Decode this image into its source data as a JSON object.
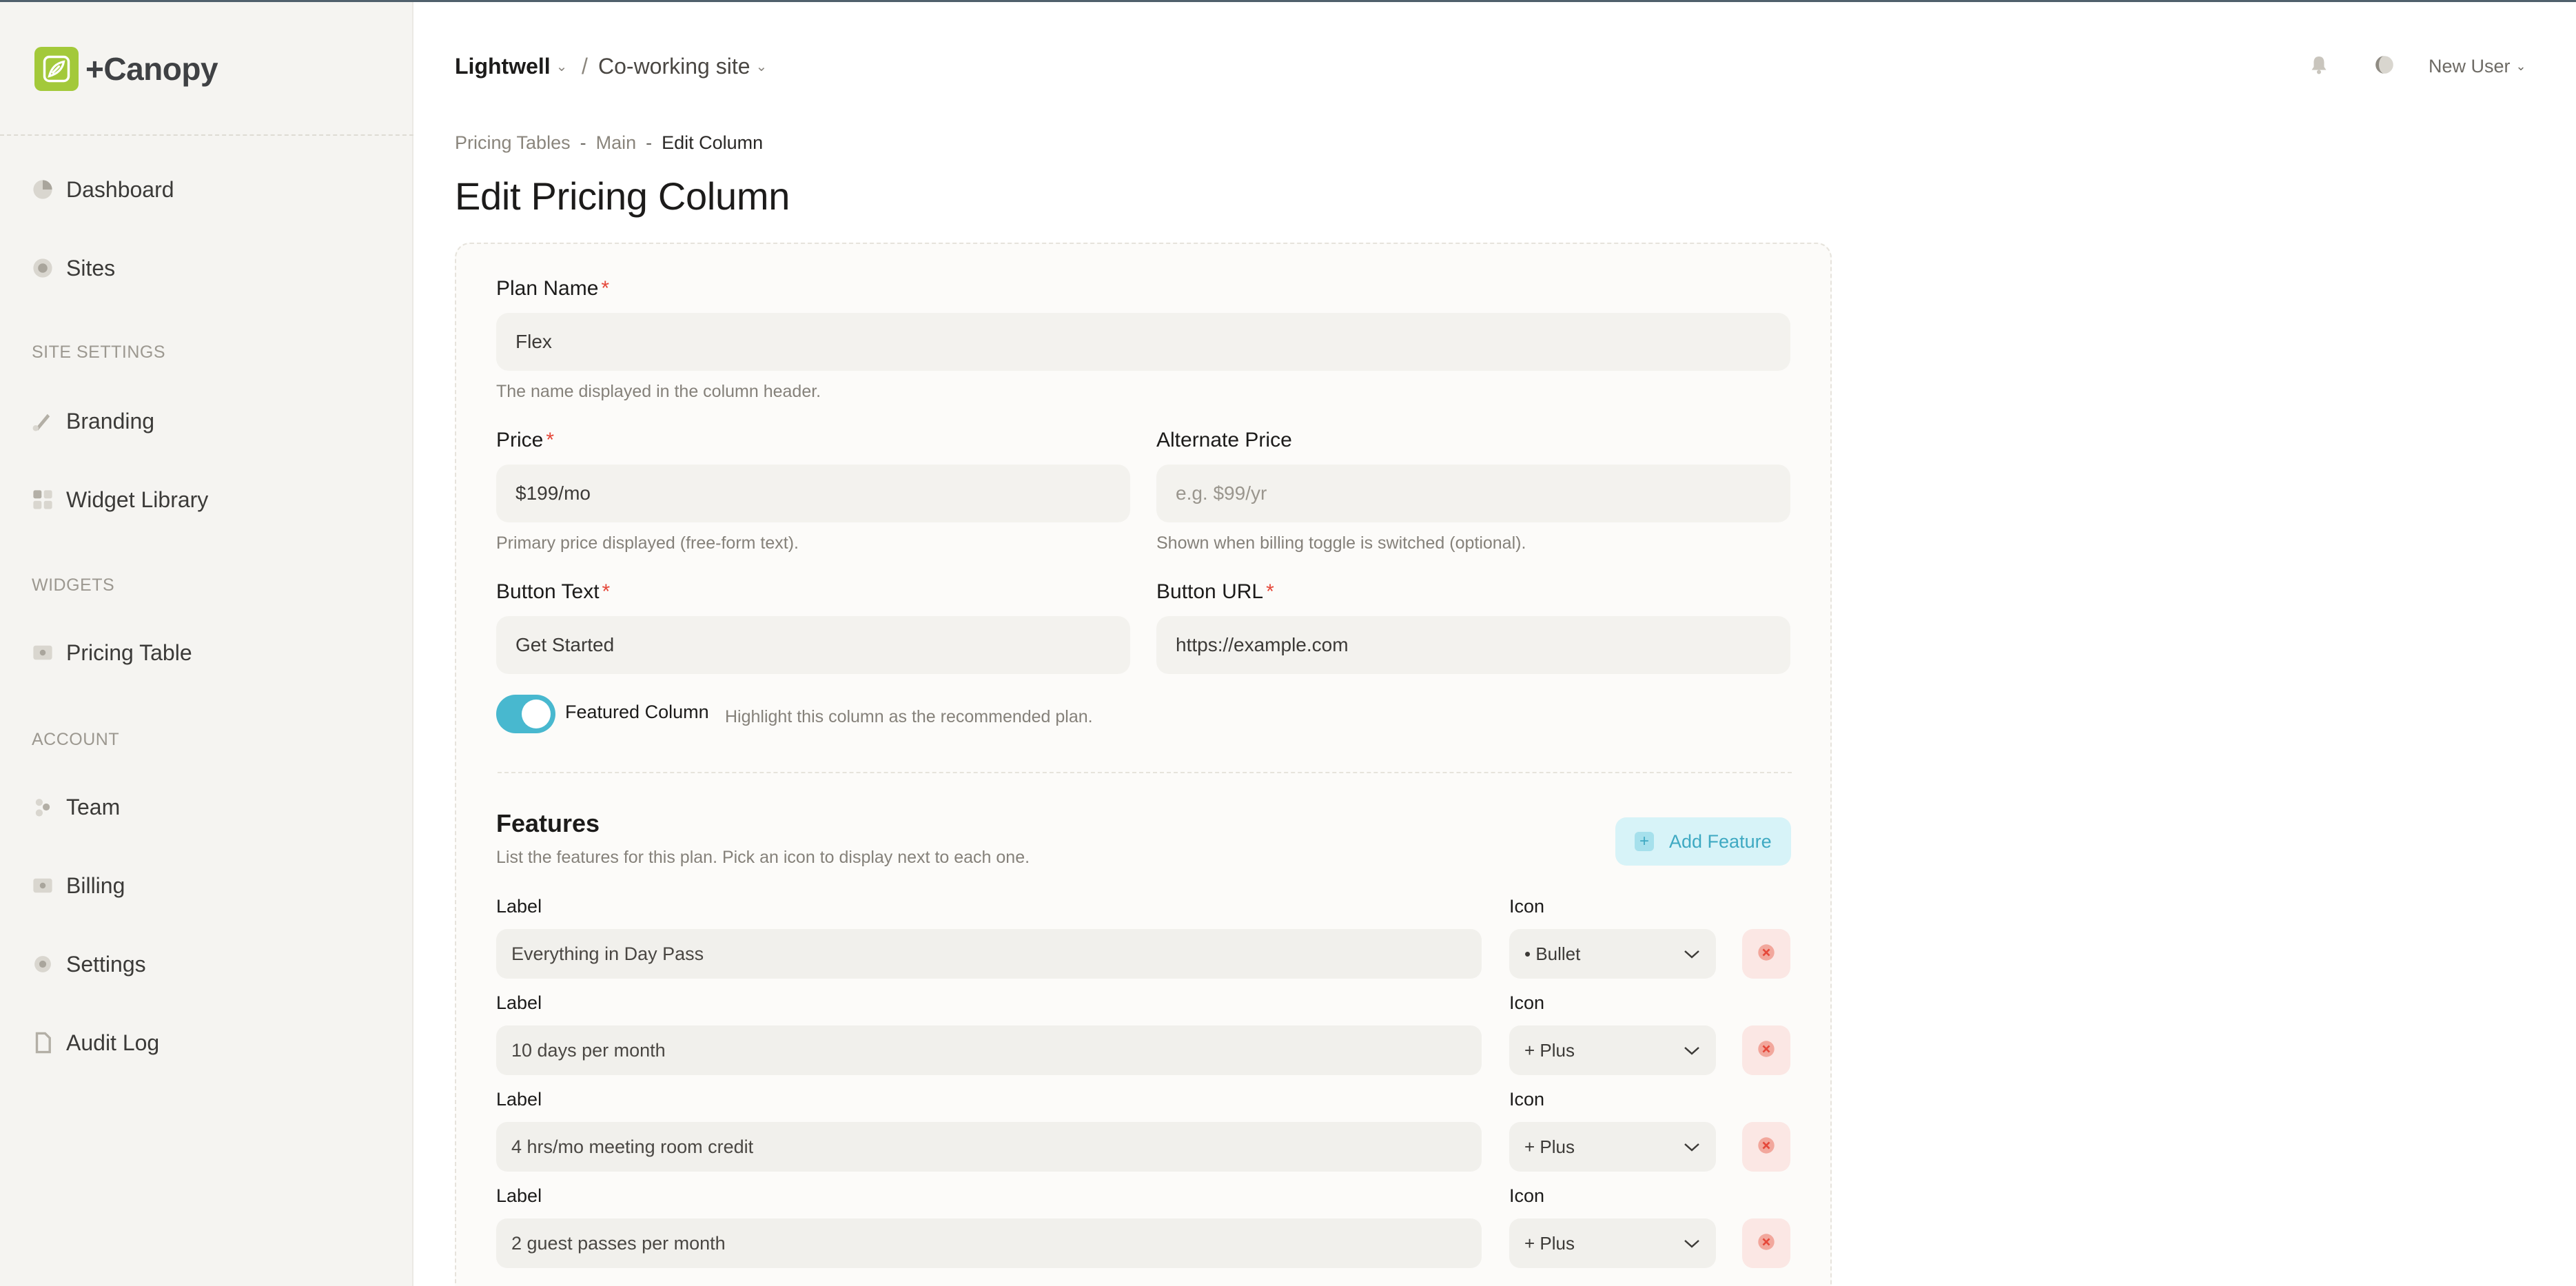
{
  "brand": {
    "name": "+Canopy"
  },
  "sidebar": {
    "items_top": [
      {
        "label": "Dashboard",
        "icon": "pie-chart-icon"
      },
      {
        "label": "Sites",
        "icon": "globe-icon"
      }
    ],
    "section_site": "SITE SETTINGS",
    "items_site": [
      {
        "label": "Branding",
        "icon": "brush-icon"
      },
      {
        "label": "Widget Library",
        "icon": "grid-icon"
      }
    ],
    "section_widgets": "WIDGETS",
    "items_widgets": [
      {
        "label": "Pricing Table",
        "icon": "table-icon"
      }
    ],
    "section_account": "ACCOUNT",
    "items_account": [
      {
        "label": "Team",
        "icon": "users-icon"
      },
      {
        "label": "Billing",
        "icon": "card-icon"
      },
      {
        "label": "Settings",
        "icon": "gear-icon"
      },
      {
        "label": "Audit Log",
        "icon": "document-icon"
      }
    ]
  },
  "header": {
    "workspace": "Lightwell",
    "site_separator": "/",
    "site": "Co-working site",
    "user": "New User"
  },
  "breadcrumb": {
    "items": [
      "Pricing Tables",
      "Main",
      "Edit Column"
    ],
    "separator": "-"
  },
  "page": {
    "title": "Edit Pricing Column"
  },
  "form": {
    "required_marker": "*",
    "plan_name": {
      "label": "Plan Name",
      "value": "Flex",
      "help": "The name displayed in the column header."
    },
    "price": {
      "label": "Price",
      "value": "$199/mo",
      "help": "Primary price displayed (free-form text)."
    },
    "alt_price": {
      "label": "Alternate Price",
      "placeholder": "e.g. $99/yr",
      "help": "Shown when billing toggle is switched (optional)."
    },
    "button_text": {
      "label": "Button Text",
      "value": "Get Started"
    },
    "button_url": {
      "label": "Button URL",
      "value": "https://example.com"
    },
    "featured": {
      "label": "Featured Column",
      "help": "Highlight this column as the recommended plan.",
      "on": true
    }
  },
  "features": {
    "title": "Features",
    "description": "List the features for this plan. Pick an icon to display next to each one.",
    "add_label": "Add Feature",
    "label_header": "Label",
    "icon_header": "Icon",
    "rows": [
      {
        "label": "Everything in Day Pass",
        "icon": "• Bullet"
      },
      {
        "label": "10 days per month",
        "icon": "+ Plus"
      },
      {
        "label": "4 hrs/mo meeting room credit",
        "icon": "+ Plus"
      },
      {
        "label": "2 guest passes per month",
        "icon": "+ Plus"
      }
    ]
  },
  "colors": {
    "accent": "#48b8cf",
    "brand": "#a3c93a",
    "danger": "#e5483a"
  }
}
